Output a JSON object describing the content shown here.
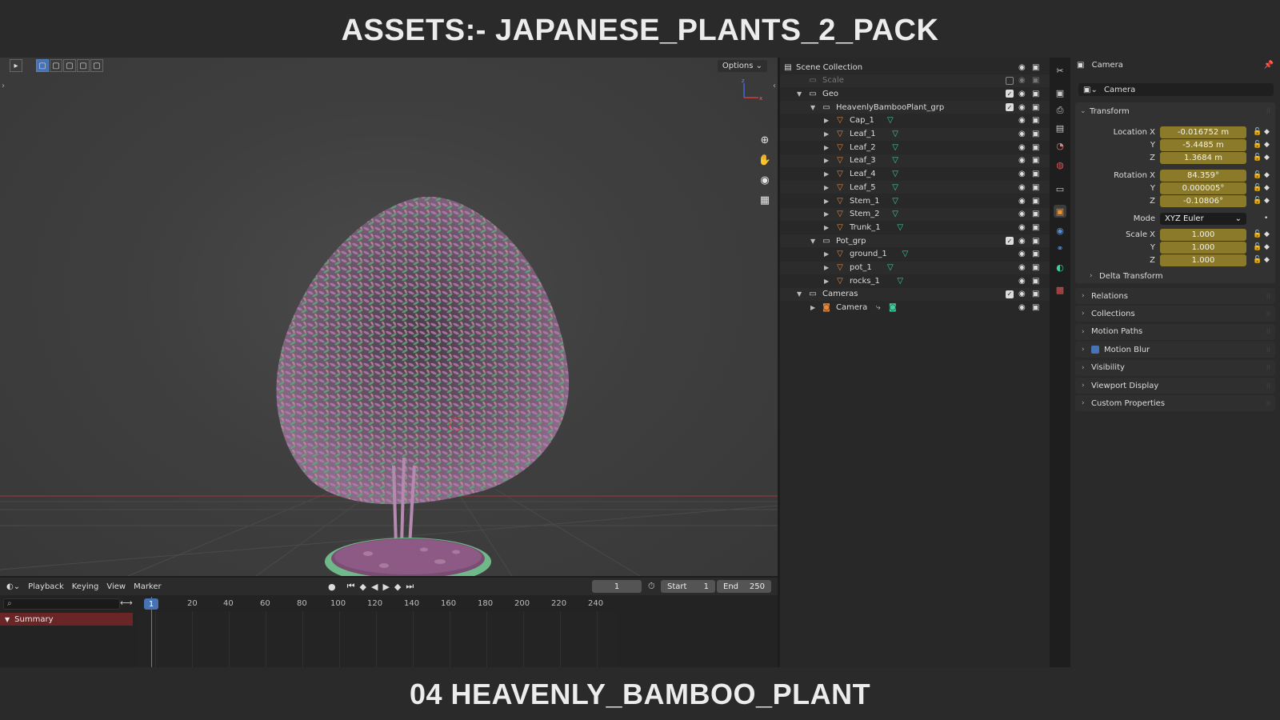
{
  "banner": {
    "top": "ASSETS:- JAPANESE_PLANTS_2_PACK",
    "bottom": "04 HEAVENLY_BAMBOO_PLANT"
  },
  "viewport": {
    "options_label": "Options"
  },
  "timeline": {
    "menus": [
      "Playback",
      "Keying",
      "View",
      "Marker"
    ],
    "current_frame": "1",
    "start_label": "Start",
    "start_value": "1",
    "end_label": "End",
    "end_value": "250",
    "ruler": [
      "1",
      "20",
      "40",
      "60",
      "80",
      "100",
      "120",
      "140",
      "160",
      "180",
      "200",
      "220",
      "240"
    ],
    "summary_label": "Summary"
  },
  "outliner": {
    "rows": [
      {
        "label": "Scene Collection",
        "level": 0,
        "type": "scene",
        "dim": false
      },
      {
        "label": "Scale",
        "level": 1,
        "type": "collection",
        "dim": true
      },
      {
        "label": "Geo",
        "level": 1,
        "type": "collection",
        "dim": false
      },
      {
        "label": "HeavenlyBambooPlant_grp",
        "level": 2,
        "type": "collection",
        "dim": false
      },
      {
        "label": "Cap_1",
        "level": 3,
        "type": "mesh",
        "dim": false
      },
      {
        "label": "Leaf_1",
        "level": 3,
        "type": "mesh",
        "dim": false
      },
      {
        "label": "Leaf_2",
        "level": 3,
        "type": "mesh",
        "dim": false
      },
      {
        "label": "Leaf_3",
        "level": 3,
        "type": "mesh",
        "dim": false
      },
      {
        "label": "Leaf_4",
        "level": 3,
        "type": "mesh",
        "dim": false
      },
      {
        "label": "Leaf_5",
        "level": 3,
        "type": "mesh",
        "dim": false
      },
      {
        "label": "Stem_1",
        "level": 3,
        "type": "mesh",
        "dim": false
      },
      {
        "label": "Stem_2",
        "level": 3,
        "type": "mesh",
        "dim": false
      },
      {
        "label": "Trunk_1",
        "level": 3,
        "type": "mesh",
        "dim": false
      },
      {
        "label": "Pot_grp",
        "level": 2,
        "type": "collection",
        "dim": false
      },
      {
        "label": "ground_1",
        "level": 3,
        "type": "mesh",
        "dim": false
      },
      {
        "label": "pot_1",
        "level": 3,
        "type": "mesh",
        "dim": false
      },
      {
        "label": "rocks_1",
        "level": 3,
        "type": "mesh",
        "dim": false
      },
      {
        "label": "Cameras",
        "level": 1,
        "type": "collection",
        "dim": false
      },
      {
        "label": "Camera",
        "level": 2,
        "type": "camera",
        "dim": false
      }
    ]
  },
  "properties": {
    "header_title": "Camera",
    "object_name": "Camera",
    "transform": {
      "title": "Transform",
      "location_x_label": "Location X",
      "location_x": "-0.016752 m",
      "location_y": "-5.4485 m",
      "location_z": "1.3684 m",
      "rotation_x_label": "Rotation X",
      "rotation_x": "84.359°",
      "rotation_y": "0.000005°",
      "rotation_z": "-0.10806°",
      "mode_label": "Mode",
      "mode_value": "XYZ Euler",
      "scale_x_label": "Scale X",
      "scale_x": "1.000",
      "scale_y": "1.000",
      "scale_z": "1.000",
      "y_label": "Y",
      "z_label": "Z",
      "delta": "Delta Transform"
    },
    "panels": [
      "Relations",
      "Collections",
      "Motion Paths",
      "Motion Blur",
      "Visibility",
      "Viewport Display",
      "Custom Properties"
    ]
  },
  "colors": {
    "field_yellow": "#8a7a2a",
    "accent_blue": "#4772b3",
    "summary_red": "#6a2626",
    "mesh_orange": "#e8873a",
    "mesh_green": "#3fcf9a"
  }
}
